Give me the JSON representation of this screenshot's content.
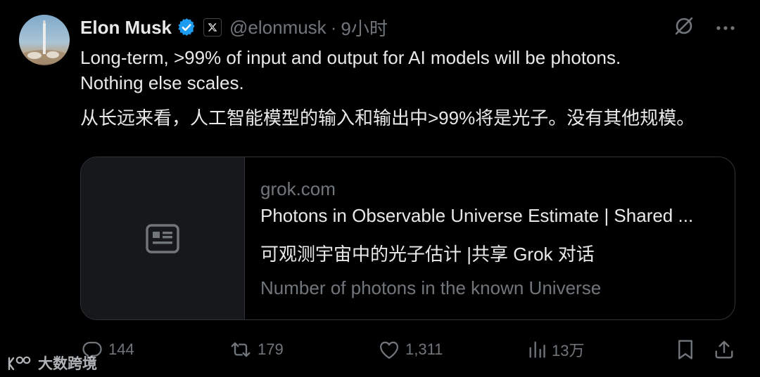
{
  "author": {
    "name": "Elon Musk",
    "handle": "@elonmusk",
    "separator": "·",
    "time": "9小时"
  },
  "tweet": {
    "line1": "Long-term, >99% of input and output for AI models will be photons.",
    "line2": "Nothing else scales.",
    "translation": "从长远来看，人工智能模型的输入和输出中>99%将是光子。没有其他规模。"
  },
  "card": {
    "domain": "grok.com",
    "title": "Photons in Observable Universe Estimate | Shared ...",
    "subtitle": "可观测宇宙中的光子估计 |共享 Grok 对话",
    "description": "Number of photons in the known Universe"
  },
  "actions": {
    "replies": "144",
    "reposts": "179",
    "likes": "1,311",
    "views": "13万"
  },
  "watermark": {
    "text": "大数跨境"
  },
  "colors": {
    "background": "#000000",
    "text": "#e7e9ea",
    "muted": "#71767b",
    "border": "#2f3336",
    "verified": "#1d9bf0",
    "card_media": "#16181c"
  }
}
